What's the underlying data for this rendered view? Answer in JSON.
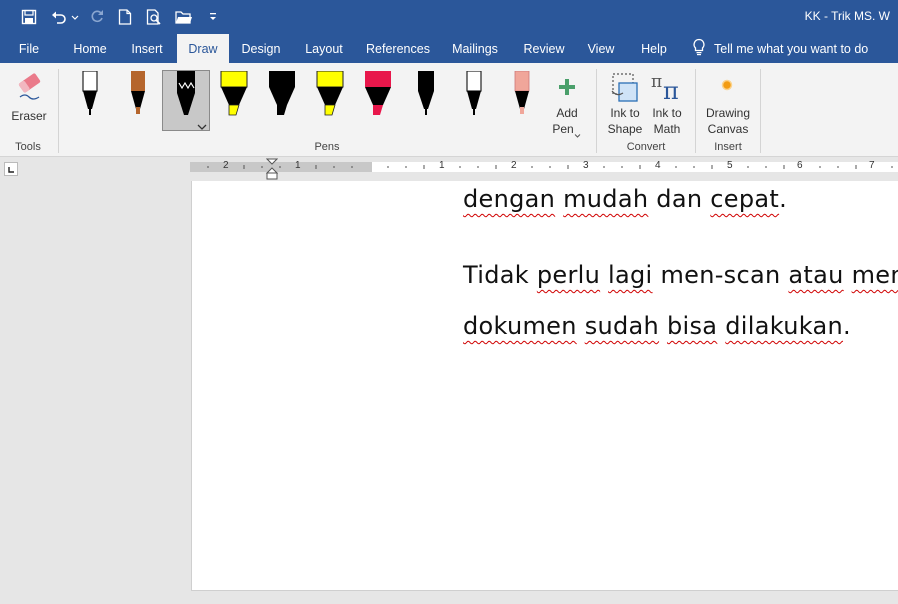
{
  "window": {
    "title": "KK - Trik MS. W"
  },
  "quick_access": {
    "save": "save-icon",
    "undo": "undo-icon",
    "redo": "redo-icon",
    "new": "new-document-icon",
    "print_preview": "print-preview-icon",
    "open": "open-folder-icon",
    "customize": "customize-qat-icon"
  },
  "tabs": [
    "File",
    "Home",
    "Insert",
    "Draw",
    "Design",
    "Layout",
    "References",
    "Mailings",
    "Review",
    "View",
    "Help"
  ],
  "active_tab": "Draw",
  "tell_me": "Tell me what you want to do",
  "ribbon": {
    "tools": {
      "label": "Tools",
      "eraser": "Eraser"
    },
    "pens": {
      "label": "Pens",
      "add_pen_line1": "Add",
      "add_pen_line2": "Pen",
      "items": [
        {
          "name": "black-pen",
          "color": "#000000"
        },
        {
          "name": "pencil-brown",
          "color": "#b5652c"
        },
        {
          "name": "black-galaxy-pen",
          "color": "#000000"
        },
        {
          "name": "yellow-highlighter",
          "color": "#ffff00"
        },
        {
          "name": "black-highlighter",
          "color": "#000000"
        },
        {
          "name": "yellow-highlighter-2",
          "color": "#ffff00"
        },
        {
          "name": "red-highlighter",
          "color": "#e8174b"
        },
        {
          "name": "black-pen-2",
          "color": "#000000"
        },
        {
          "name": "black-pen-3",
          "color": "#000000"
        },
        {
          "name": "pink-pen",
          "color": "#f0a69a"
        }
      ]
    },
    "convert": {
      "label": "Convert",
      "ink_to_shape_1": "Ink to",
      "ink_to_shape_2": "Shape",
      "ink_to_math_1": "Ink to",
      "ink_to_math_2": "Math"
    },
    "insert": {
      "label": "Insert",
      "drawing_canvas_1": "Drawing",
      "drawing_canvas_2": "Canvas"
    }
  },
  "ruler": {
    "left_numbers": [
      "2",
      "1"
    ],
    "right_numbers": [
      "1",
      "2",
      "3",
      "4",
      "5",
      "6",
      "7"
    ]
  },
  "document": {
    "line1": [
      {
        "t": "dengan",
        "sq": true
      },
      {
        "t": " "
      },
      {
        "t": "mudah",
        "sq": true
      },
      {
        "t": " dan "
      },
      {
        "t": "cepat",
        "sq": true
      },
      {
        "t": "."
      }
    ],
    "line2": [
      {
        "t": "Tidak "
      },
      {
        "t": "perlu",
        "sq": true
      },
      {
        "t": " "
      },
      {
        "t": "lagi",
        "sq": true
      },
      {
        "t": " men-scan "
      },
      {
        "t": "atau",
        "sq": true
      },
      {
        "t": " "
      },
      {
        "t": "menga",
        "sq": true
      }
    ],
    "line3": [
      {
        "t": "dokumen",
        "sq": true
      },
      {
        "t": " "
      },
      {
        "t": "sudah",
        "sq": true
      },
      {
        "t": " "
      },
      {
        "t": "bisa",
        "sq": true
      },
      {
        "t": " "
      },
      {
        "t": "dilakukan",
        "sq": true
      },
      {
        "t": "."
      }
    ]
  }
}
